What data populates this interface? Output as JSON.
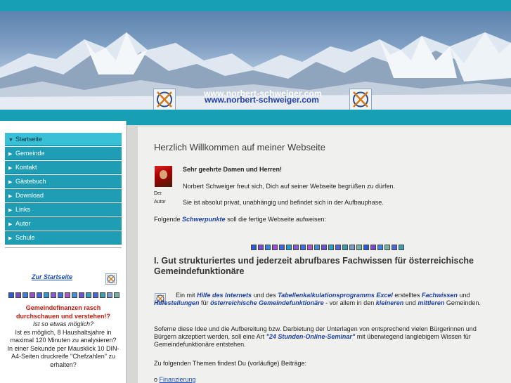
{
  "banner": {
    "site_url": "www.norbert-schweiger.com",
    "logo_icon": "cross-circle-logo-icon"
  },
  "nav": {
    "items": [
      {
        "label": "Startseite",
        "active": true
      },
      {
        "label": "Gemeinde",
        "active": false
      },
      {
        "label": "Kontakt",
        "active": false
      },
      {
        "label": "Gästebuch",
        "active": false
      },
      {
        "label": "Download",
        "active": false
      },
      {
        "label": "Links",
        "active": false
      },
      {
        "label": "Autor",
        "active": false
      },
      {
        "label": "Schule",
        "active": false
      }
    ]
  },
  "sidebar": {
    "start_link": "Zur Startseite",
    "promo_title": "Gemeindefinanzen rasch durchschauen und verstehen!?",
    "promo_question": "Ist so etwas möglich?",
    "promo_line1": "Ist es möglich, 8 Haushaltsjahre in maximal 120 Minuten zu analysieren?",
    "promo_line2": "In einer Sekunde per Mausklick 10 DIN-A4-Seiten druckreife \"Chefzahlen\" zu erhalten?"
  },
  "colors": {
    "teal": "#17a0b5",
    "square_colors": [
      "#2c5bd6",
      "#7a4bc9",
      "#3a7fdc",
      "#9b4fd0",
      "#4466dd",
      "#2c9ac8",
      "#8a5ad5",
      "#3f6ee0",
      "#ad58c8",
      "#3c8fd7",
      "#6b56cf",
      "#2f9fbf",
      "#4e68d9",
      "#3aa0b0",
      "#7f96c8",
      "#6fb3a0"
    ]
  },
  "main": {
    "welcome_title": "Herzlich Willkommen auf meiner Webseite",
    "greeting": "Sehr geehrte Damen und Herren!",
    "intro": "Norbert Schweiger freut sich, Dich auf seiner Webseite begrüßen zu dürfen.",
    "status": "Sie ist absolut privat, unabhängig und befindet sich in der Aufbauphase.",
    "author_caption_1": "Der",
    "author_caption_2": "Autor",
    "focus_pre": "Folgende",
    "focus_em": "Schwerpunkte",
    "focus_post": "soll die fertige Webseite aufweisen:",
    "section_title": "I. Gut strukturiertes und jederzeit abrufbares Fachwissen für österreichische Gemeindefunktionäre",
    "para1_a": "Ein mit",
    "para1_b": "Hilfe des Internets",
    "para1_c": "und des",
    "para1_d": "Tabellenkalkulationsprogramms Excel",
    "para1_e": "erstelltes",
    "para1_f": "Fachwissen",
    "para1_g": "und",
    "para1_h": "Hilfestellungen",
    "para1_i": "für",
    "para1_j": "österreichische",
    "para1_k": "Gemeindefunktionäre",
    "para1_l": "- vor allem in den",
    "para1_m": "kleineren",
    "para1_n": "und",
    "para1_o": "mittleren",
    "para1_p": "Gemeinden.",
    "para2_a": "Soferne diese Idee und die Aufbereitung bzw. Darbietung der Unterlagen von entsprechend vielen Bürgerinnen und Bürgern akzeptiert werden, soll eine Art",
    "para2_b": "\"24 Stunden-Online-Seminar\"",
    "para2_c": "mit überwiegend langlebigem Wissen für Gemeindefunktionäre entstehen.",
    "topics_intro": "Zu folgenden Themen findest Du (vorläufige) Beiträge:",
    "topic_bullet": "o",
    "topic_1": "Finanzierung"
  }
}
